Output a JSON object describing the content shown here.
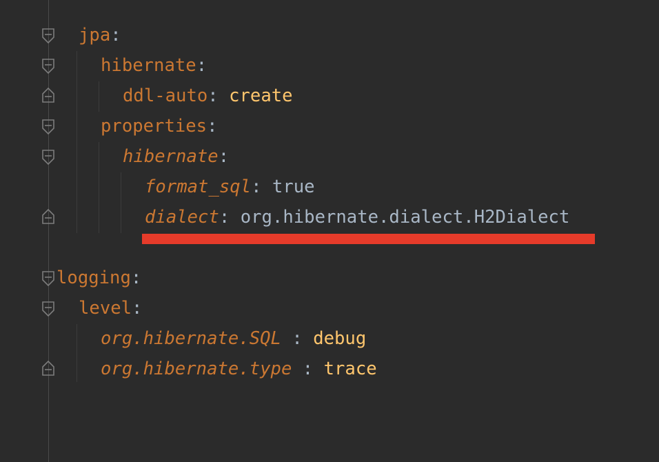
{
  "editor": {
    "lines": [
      {
        "key": "jpa",
        "sep": ":",
        "value": "",
        "fold": "open"
      },
      {
        "key": "hibernate",
        "sep": ":",
        "value": "",
        "fold": "open"
      },
      {
        "key": "ddl-auto",
        "sep": ": ",
        "value": "create",
        "fold": "close"
      },
      {
        "key": "properties",
        "sep": ":",
        "value": "",
        "fold": "open"
      },
      {
        "key": "hibernate",
        "sep": ":",
        "value": "",
        "fold": "open"
      },
      {
        "key": "format_sql",
        "sep": ": ",
        "value": "true",
        "fold": "none"
      },
      {
        "key": "dialect",
        "sep": ": ",
        "value": "org.hibernate.dialect.H2Dialect",
        "fold": "close"
      },
      {
        "key": "logging",
        "sep": ":",
        "value": "",
        "fold": "open"
      },
      {
        "key": "level",
        "sep": ":",
        "value": "",
        "fold": "open"
      },
      {
        "key": "org.hibernate.SQL",
        "sep": " : ",
        "value": "debug",
        "fold": "none"
      },
      {
        "key": "org.hibernate.type",
        "sep": " : ",
        "value": "trace",
        "fold": "close"
      }
    ]
  },
  "colors": {
    "background": "#2b2b2b",
    "key": "#cc7832",
    "value": "#ffc66d",
    "plain": "#a9b7c6",
    "highlight_underline": "#e63b2a"
  }
}
